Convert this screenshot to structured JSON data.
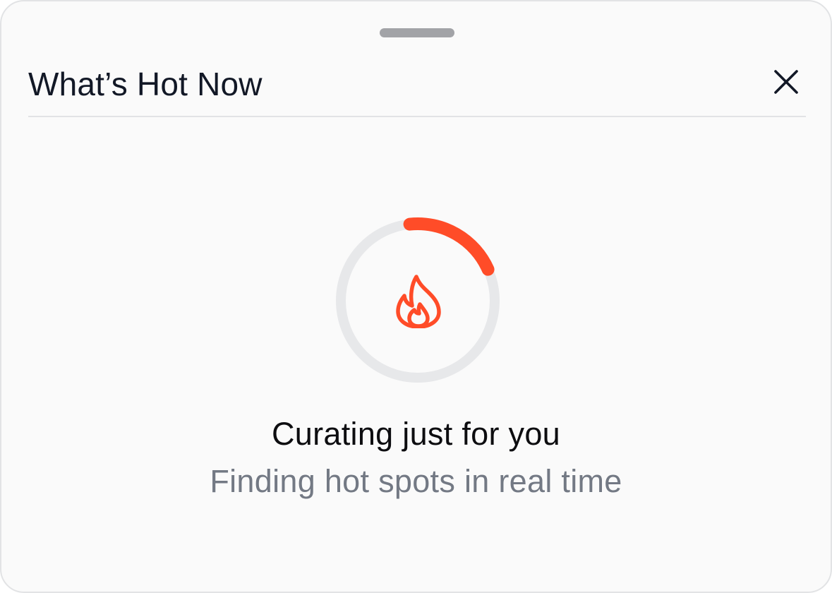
{
  "sheet": {
    "title": "What’s Hot Now",
    "close_icon": "close-icon"
  },
  "loading": {
    "progress": 0.2,
    "icon": "flame-icon",
    "title": "Curating just for you",
    "subtitle": "Finding hot spots in real time"
  },
  "colors": {
    "accent": "#ff4c28",
    "track": "#e7e8ea",
    "title_text": "#121826",
    "subtitle_text": "#737984"
  }
}
